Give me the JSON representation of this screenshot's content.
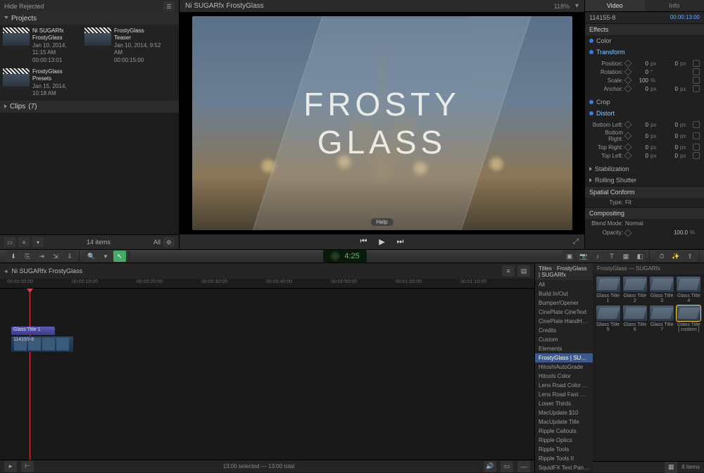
{
  "browser": {
    "hide_rejected": "Hide Rejected",
    "projects_header": "Projects",
    "clips_header": "Clips",
    "clips_count": "(7)",
    "items_count": "14 items",
    "all_label": "All",
    "projects": [
      {
        "title": "Ni SUGARfx FrostyGlass",
        "date": "Jan 10, 2014, 11:15 AM",
        "dur": "00:00:13:01"
      },
      {
        "title": "FrostyGlass Teaser",
        "date": "Jan 10, 2014, 9:52 AM",
        "dur": "00:00:15:00"
      },
      {
        "title": "FrostyGlass Presets",
        "date": "Jan 15, 2014, 10:18 AM",
        "dur": ""
      }
    ]
  },
  "viewer": {
    "title": "Ni SUGARfx FrostyGlass",
    "zoom": "118%",
    "overlay_line1": "FROSTY",
    "overlay_line2": "GLASS",
    "help": "Help"
  },
  "inspector": {
    "tabs": {
      "video": "Video",
      "info": "Info"
    },
    "clip_name": "114155-8",
    "clip_tc": "00:00:13:00",
    "effects_header": "Effects",
    "color": {
      "label": "Color"
    },
    "transform": {
      "label": "Transform",
      "rows": [
        {
          "lbl": "Position:",
          "x": "0",
          "xu": "px",
          "y": "0",
          "yu": "px"
        },
        {
          "lbl": "Rotation:",
          "x": "0",
          "xu": "°",
          "y": "",
          "yu": ""
        },
        {
          "lbl": "Scale:",
          "x": "100",
          "xu": "%",
          "y": "",
          "yu": ""
        },
        {
          "lbl": "Anchor:",
          "x": "0",
          "xu": "px",
          "y": "0",
          "yu": "px"
        }
      ]
    },
    "crop": {
      "label": "Crop"
    },
    "distort": {
      "label": "Distort",
      "rows": [
        {
          "lbl": "Bottom Left:",
          "x": "0",
          "xu": "px",
          "y": "0",
          "yu": "px"
        },
        {
          "lbl": "Bottom Right:",
          "x": "0",
          "xu": "px",
          "y": "0",
          "yu": "px"
        },
        {
          "lbl": "Top Right:",
          "x": "0",
          "xu": "px",
          "y": "0",
          "yu": "px"
        },
        {
          "lbl": "Top Left:",
          "x": "0",
          "xu": "px",
          "y": "0",
          "yu": "px"
        }
      ]
    },
    "stabilization": "Stabilization",
    "rolling_shutter": "Rolling Shutter",
    "spatial_conform": {
      "label": "Spatial Conform",
      "type_lbl": "Type:",
      "type_val": "Fit"
    },
    "compositing": {
      "label": "Compositing",
      "blend_lbl": "Blend Mode:",
      "blend_val": "Normal",
      "opacity_lbl": "Opacity:",
      "opacity_val": "100.0",
      "opacity_unit": "%"
    }
  },
  "timecode": "4:25",
  "timeline": {
    "project": "Ni SUGARfx FrostyGlass",
    "ruler": [
      "00:00:00:00",
      "00:00:10:00",
      "00:00:20:00",
      "00:00:30:00",
      "00:00:40:00",
      "00:00:50:00",
      "00:01:00:00",
      "00:01:10:00"
    ],
    "title_clip": "Glass Title 1",
    "video_clip": "114155-8",
    "footer": "13:00 selected — 13:00 total"
  },
  "titles": {
    "header": "Titles",
    "breadcrumb": "FrostyGlass | SUGARfx",
    "grid_head": "FrostyGlass — SUGARfx",
    "categories": [
      "All",
      "Build In/Out",
      "Bumper/Opener",
      "CinePlate CineText",
      "CinePlate HandHeld",
      "Credits",
      "Custom",
      "Elements",
      "FrostyGlass | SUGARfx",
      "HitoshiAutoGrade",
      "Hitoshi Color",
      "Lens Road Color Pre...",
      "Lens Road Fast Mask",
      "Lower Thirds",
      "MacUpdate $10",
      "MacUpdate Title",
      "Ripple Callouts",
      "Ripple Optics",
      "Ripple Tools",
      "Ripple Tools II",
      "SquidFX Text Panels"
    ],
    "selected_cat": 8,
    "items": [
      "Glass Title 1",
      "Glass Title 2",
      "Glass Title 3",
      "Glass Title 4",
      "Glass Title 5",
      "Glass Title 6",
      "Glass Title 7",
      "Glass Title [ custom ]"
    ],
    "count": "8 items"
  }
}
